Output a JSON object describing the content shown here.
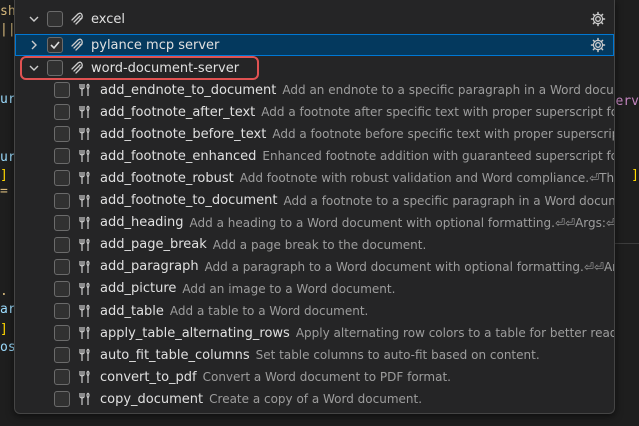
{
  "background": {
    "left_lines": [
      {
        "text": "shm",
        "color": "#d7ba7d"
      },
      {
        "text": "||",
        "color": "#d7ba7d"
      },
      {
        "text": "url",
        "color": "#9cdcfe"
      },
      {
        "text": "ur",
        "color": "#9cdcfe"
      },
      {
        "text": "]",
        "color": "#ffd700"
      },
      {
        "text": "=",
        "color": "#d7ba7d"
      },
      {
        "text": ".",
        "color": "#d7ba7d"
      },
      {
        "text": "art",
        "color": "#9cdcfe"
      },
      {
        "text": "]",
        "color": "#ffd700"
      },
      {
        "text": "ost",
        "color": "#9cdcfe"
      }
    ],
    "right_lines": [
      {
        "text": "Serv",
        "color": "#c586c0"
      },
      {
        "text": "]",
        "color": "#ffd700"
      }
    ]
  },
  "servers": [
    {
      "label": "excel",
      "checked": false,
      "expanded": false
    },
    {
      "label": "pylance mcp server",
      "checked": true,
      "expanded": false,
      "selected": true
    },
    {
      "label": "word-document-server",
      "checked": false,
      "expanded": true
    }
  ],
  "tools": [
    {
      "name": "add_endnote_to_document",
      "desc": "Add an endnote to a specific paragraph in a Word document."
    },
    {
      "name": "add_footnote_after_text",
      "desc": "Add a footnote after specific text with proper superscript formatting...."
    },
    {
      "name": "add_footnote_before_text",
      "desc": "Add a footnote before specific text with proper superscript formatti..."
    },
    {
      "name": "add_footnote_enhanced",
      "desc": "Enhanced footnote addition with guaranteed superscript formatting...."
    },
    {
      "name": "add_footnote_robust",
      "desc": "Add footnote with robust validation and Word compliance.⏎This is the ..."
    },
    {
      "name": "add_footnote_to_document",
      "desc": "Add a footnote to a specific paragraph in a Word document."
    },
    {
      "name": "add_heading",
      "desc": "Add a heading to a Word document with optional formatting.⏎⏎Args:⏎    filena..."
    },
    {
      "name": "add_page_break",
      "desc": "Add a page break to the document."
    },
    {
      "name": "add_paragraph",
      "desc": "Add a paragraph to a Word document with optional formatting.⏎⏎Args:⏎    f..."
    },
    {
      "name": "add_picture",
      "desc": "Add an image to a Word document."
    },
    {
      "name": "add_table",
      "desc": "Add a table to a Word document."
    },
    {
      "name": "apply_table_alternating_rows",
      "desc": "Apply alternating row colors to a table for better readability."
    },
    {
      "name": "auto_fit_table_columns",
      "desc": "Set table columns to auto-fit based on content."
    },
    {
      "name": "convert_to_pdf",
      "desc": "Convert a Word document to PDF format."
    },
    {
      "name": "copy_document",
      "desc": "Create a copy of a Word document."
    }
  ],
  "colors": {
    "selected_bg": "#04395e",
    "focus_border": "#0078d4",
    "highlight_box": "#e05252"
  },
  "icons": {
    "server": "mcp-server-icon",
    "tool": "tool-icon",
    "configure": "gear-icon",
    "expand": "chevron-right-icon",
    "collapse": "chevron-down-icon"
  }
}
